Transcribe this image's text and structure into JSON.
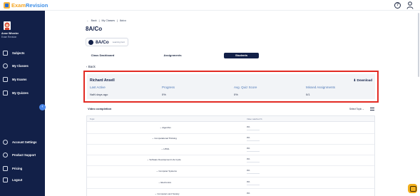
{
  "app": {
    "logo_part1": "Exam",
    "logo_part2": "Revision"
  },
  "user": {
    "name": "Anne Wheeler",
    "school": "Exam Revision"
  },
  "sidebar": {
    "items": [
      {
        "label": "Subjects",
        "icon": "book-icon"
      },
      {
        "label": "My Classes",
        "icon": "users-icon"
      },
      {
        "label": "My Exams",
        "icon": "open-book-icon"
      },
      {
        "label": "My Quizzes",
        "icon": "quiz-icon"
      },
      {
        "label": "Account Settings",
        "icon": "gear-icon"
      },
      {
        "label": "Product Support",
        "icon": "help-icon"
      },
      {
        "label": "Pricing",
        "icon": "card-icon"
      },
      {
        "label": "Logout",
        "icon": "logout-icon"
      }
    ],
    "collapse_glyph": "‹"
  },
  "breadcrumb": {
    "back": "Back",
    "sep": "|",
    "level1": "My Classes",
    "level2": "8a/co"
  },
  "page": {
    "title": "8A/Co"
  },
  "class_chip": {
    "name": "8A/Co",
    "subtitle": "Learning Cert"
  },
  "tabs": [
    {
      "label": "Class Dashboard"
    },
    {
      "label": "Assignments"
    },
    {
      "label": "Students",
      "active": true
    }
  ],
  "back_link": "Back",
  "summary": {
    "student_name": "Richard Ansell",
    "download_label": "Download",
    "stats": [
      {
        "label": "Last Active",
        "value": "NaN days ago"
      },
      {
        "label": "Progress",
        "value": "0%"
      },
      {
        "label": "Avg. Quiz Score",
        "value": "0%"
      },
      {
        "label": "Missed Assignments",
        "value": "0/1"
      }
    ]
  },
  "video_completion": {
    "title": "Video completion",
    "select_label": "Select Topic",
    "col_topic": "Topic",
    "col_watched": "Video watched %",
    "rows": [
      {
        "topic": "Algorithm",
        "pct": "0%"
      },
      {
        "topic": "Computational Thinking",
        "pct": "0%"
      },
      {
        "topic": "HTML",
        "pct": "0%"
      },
      {
        "topic": "Software Development Life Cycle",
        "pct": "0%"
      },
      {
        "topic": "Computer Systems",
        "pct": "0%"
      },
      {
        "topic": "Electronics",
        "pct": "0%"
      },
      {
        "topic": "Computers and Society",
        "pct": "0%"
      }
    ]
  },
  "colors": {
    "sidebar": "#122048",
    "highlight": "#e22b24",
    "accent": "#4f79b8",
    "chat": "#f2b01e"
  }
}
